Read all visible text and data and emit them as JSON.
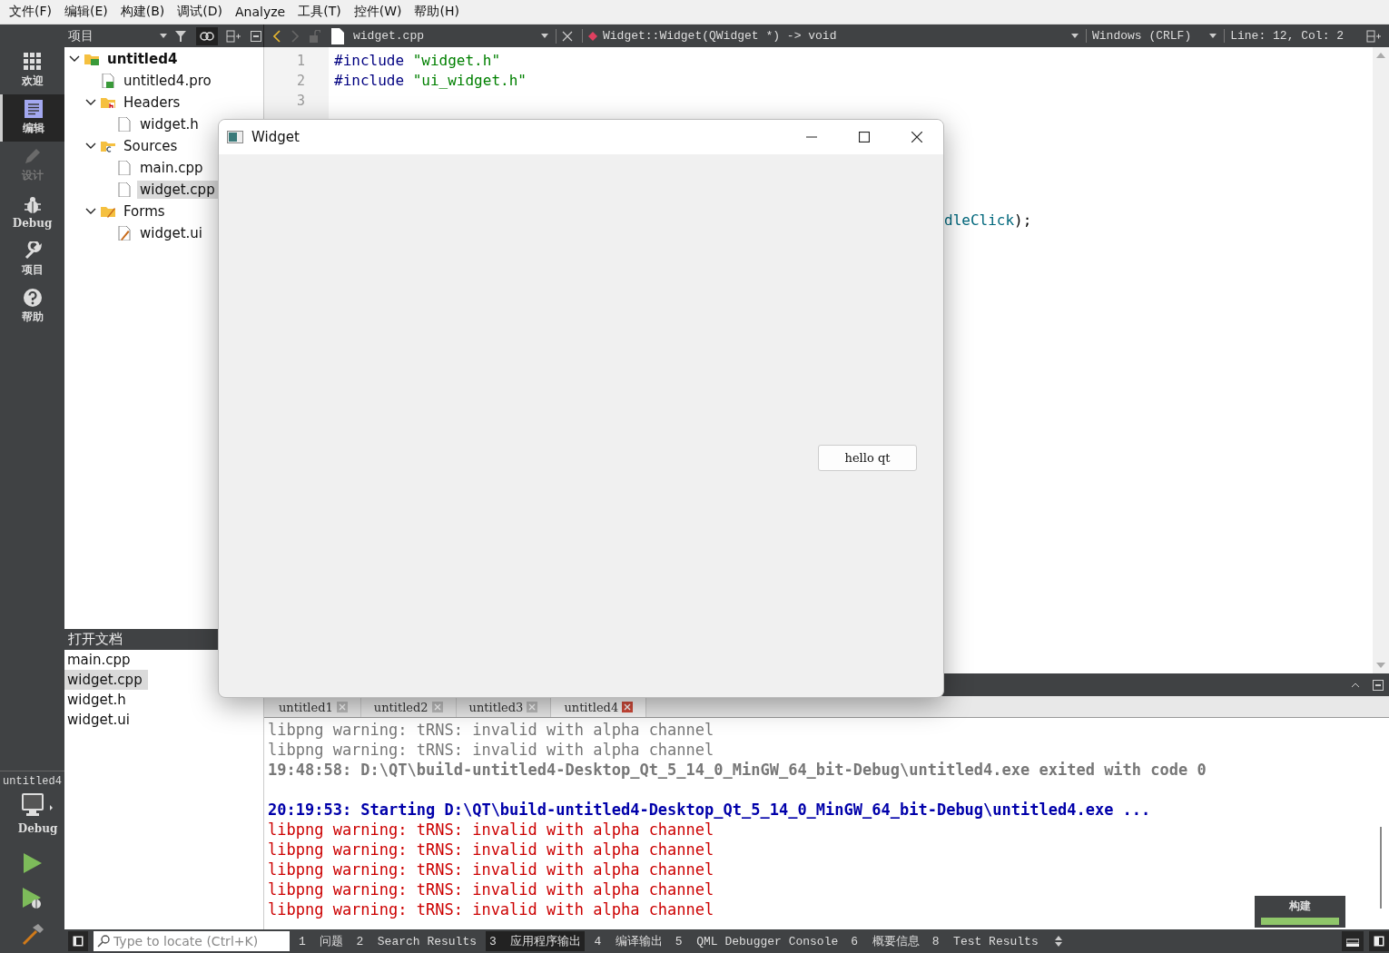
{
  "menu": [
    "文件(F)",
    "编辑(E)",
    "构建(B)",
    "调试(D)",
    "Analyze",
    "工具(T)",
    "控件(W)",
    "帮助(H)"
  ],
  "modes": [
    {
      "label": "欢迎",
      "selected": false,
      "disabled": false
    },
    {
      "label": "编辑",
      "selected": true,
      "disabled": false
    },
    {
      "label": "设计",
      "selected": false,
      "disabled": true
    },
    {
      "label": "Debug",
      "selected": false,
      "disabled": false
    },
    {
      "label": "项目",
      "selected": false,
      "disabled": false
    },
    {
      "label": "帮助",
      "selected": false,
      "disabled": false
    }
  ],
  "target": {
    "project": "untitled4",
    "config": "Debug"
  },
  "project_panel": {
    "title": "项目",
    "tree": [
      {
        "label": "untitled4",
        "kind": "project",
        "expanded": true,
        "selected": false,
        "children": [
          {
            "label": "untitled4.pro",
            "kind": "pro",
            "selected": false
          },
          {
            "label": "Headers",
            "kind": "headers",
            "expanded": true,
            "selected": false,
            "children": [
              {
                "label": "widget.h",
                "kind": "file",
                "selected": false
              }
            ]
          },
          {
            "label": "Sources",
            "kind": "sources",
            "expanded": true,
            "selected": false,
            "children": [
              {
                "label": "main.cpp",
                "kind": "file",
                "selected": false
              },
              {
                "label": "widget.cpp",
                "kind": "file",
                "selected": true
              }
            ]
          },
          {
            "label": "Forms",
            "kind": "forms",
            "expanded": true,
            "selected": false,
            "children": [
              {
                "label": "widget.ui",
                "kind": "ui",
                "selected": false
              }
            ]
          }
        ]
      }
    ]
  },
  "open_documents": {
    "title": "打开文档",
    "items": [
      {
        "label": "main.cpp",
        "selected": false
      },
      {
        "label": "widget.cpp",
        "selected": true
      },
      {
        "label": "widget.h",
        "selected": false
      },
      {
        "label": "widget.ui",
        "selected": false
      }
    ]
  },
  "editor_bar": {
    "file": "widget.cpp",
    "symbol": "Widget::Widget(QWidget *) -> void",
    "line_endings": "Windows (CRLF)",
    "position": "Line: 12, Col: 2"
  },
  "code_lines": [
    {
      "number": "1",
      "tokens": [
        {
          "text": "#include",
          "kind": "preprocessor"
        },
        {
          "text": "\"widget.h\"",
          "kind": "string"
        }
      ]
    },
    {
      "number": "2",
      "tokens": [
        {
          "text": "#include",
          "kind": "preprocessor"
        },
        {
          "text": "\"ui_widget.h\"",
          "kind": "string"
        }
      ]
    },
    {
      "number": "3"
    }
  ],
  "covered_line": {
    "tokens": [
      {
        "text": "dleClick",
        "kind": "member"
      },
      {
        "text": ");",
        "kind": "plain"
      }
    ]
  },
  "output": {
    "tabs": [
      {
        "label": "untitled1",
        "selected": false
      },
      {
        "label": "untitled2",
        "selected": false
      },
      {
        "label": "untitled3",
        "selected": false
      },
      {
        "label": "untitled4",
        "selected": true
      }
    ],
    "lines": [
      {
        "text": "libpng warning: tRNS: invalid with alpha channel",
        "kind": "old"
      },
      {
        "text": "libpng warning: tRNS: invalid with alpha channel",
        "kind": "old"
      },
      {
        "text": "19:48:58: D:\\QT\\build-untitled4-Desktop_Qt_5_14_0_MinGW_64_bit-Debug\\untitled4.exe exited with code 0",
        "kind": "old_bold"
      },
      {
        "kind": "gap"
      },
      {
        "text": "20:19:53: Starting D:\\QT\\build-untitled4-Desktop_Qt_5_14_0_MinGW_64_bit-Debug\\untitled4.exe ...",
        "kind": "start"
      },
      {
        "text": "libpng warning: tRNS: invalid with alpha channel",
        "kind": "error"
      },
      {
        "text": "libpng warning: tRNS: invalid with alpha channel",
        "kind": "error"
      },
      {
        "text": "libpng warning: tRNS: invalid with alpha channel",
        "kind": "error"
      },
      {
        "text": "libpng warning: tRNS: invalid with alpha channel",
        "kind": "error"
      },
      {
        "text": "libpng warning: tRNS: invalid with alpha channel",
        "kind": "error"
      }
    ]
  },
  "build_progress": {
    "label": "构建",
    "level": 1
  },
  "status_bar": {
    "locator": {
      "placeholder": "Type to locate (Ctrl+K)"
    },
    "panes": [
      {
        "label": "1  问题",
        "selected": false
      },
      {
        "label": "2  Search Results",
        "selected": false
      },
      {
        "label": "3  应用程序输出",
        "selected": true
      },
      {
        "label": "4  编译输出",
        "selected": false
      },
      {
        "label": "5  QML Debugger Console",
        "selected": false
      },
      {
        "label": "6  概要信息",
        "selected": false
      },
      {
        "label": "8  Test Results",
        "selected": false
      }
    ]
  },
  "app_window": {
    "title": "Widget",
    "button": "hello qt"
  }
}
